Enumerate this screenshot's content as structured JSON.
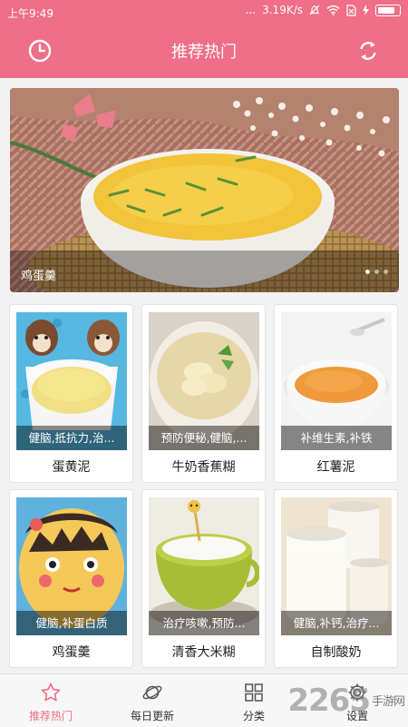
{
  "status_bar": {
    "time": "上午9:49",
    "signal": "...",
    "speed": "3.19K/s"
  },
  "header": {
    "title": "推荐热门",
    "history_icon": "clock-icon",
    "refresh_icon": "refresh-icon"
  },
  "banner": {
    "caption": "鸡蛋羹",
    "page_count": 3,
    "current_page": 1
  },
  "recipes": [
    {
      "name": "蛋黄泥",
      "tags": "健脑,抵抗力,治..."
    },
    {
      "name": "牛奶香蕉糊",
      "tags": "预防便秘,健脑,..."
    },
    {
      "name": "红薯泥",
      "tags": "补维生素,补铁"
    },
    {
      "name": "鸡蛋羹",
      "tags": "健脑,补蛋白质"
    },
    {
      "name": "清香大米糊",
      "tags": "治疗咳嗽,预防..."
    },
    {
      "name": "自制酸奶",
      "tags": "健脑,补钙,治疗..."
    }
  ],
  "tabs": [
    {
      "label": "推荐热门",
      "icon": "star-icon",
      "active": true
    },
    {
      "label": "每日更新",
      "icon": "planet-icon",
      "active": false
    },
    {
      "label": "分类",
      "icon": "grid-icon",
      "active": false
    },
    {
      "label": "设置",
      "icon": "gear-icon",
      "active": false
    }
  ],
  "watermark": {
    "number": "2265",
    "site": "手游网"
  },
  "colors": {
    "accent": "#ee6f87"
  }
}
